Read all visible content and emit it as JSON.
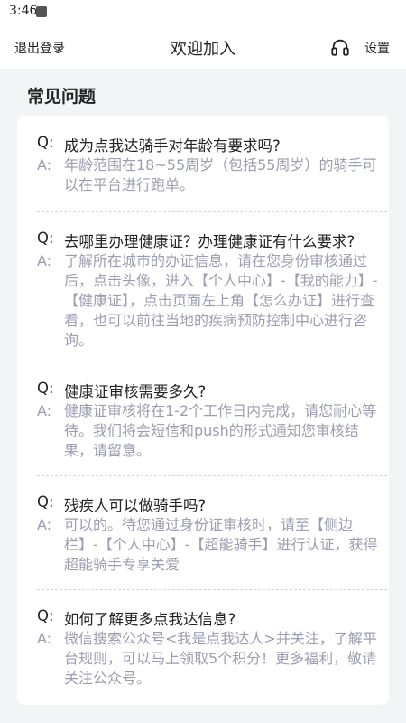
{
  "status_bar": {
    "time": "3:46"
  },
  "nav": {
    "logout": "退出登录",
    "title": "欢迎加入",
    "settings": "设置"
  },
  "faq": {
    "title": "常见问题",
    "q_prefix": "Q:",
    "a_prefix": "A:",
    "items": [
      {
        "q": "成为点我达骑手对年龄有要求吗?",
        "a": "年龄范围在18~55周岁（包括55周岁）的骑手可以在平台进行跑单。"
      },
      {
        "q": "去哪里办理健康证？办理健康证有什么要求?",
        "a": "了解所在城市的办证信息，请在您身份审核通过后，点击头像，进入【个人中心】-【我的能力】-【健康证】，点击页面左上角【怎么办证】进行查看，也可以前往当地的疾病预防控制中心进行咨询。"
      },
      {
        "q": "健康证审核需要多久?",
        "a": "健康证审核将在1-2个工作日内完成，请您耐心等待。我们将会短信和push的形式通知您审核结果，请留意。"
      },
      {
        "q": "残疾人可以做骑手吗?",
        "a": "可以的。待您通过身份证审核时，请至【侧边栏】-【个人中心】-【超能骑手】进行认证，获得超能骑手专享关爱"
      },
      {
        "q": "如何了解更多点我达信息?",
        "a": "微信搜索公众号<我是点我达人>并关注，了解平台规则，可以马上领取5个积分！更多福利，敬请关注公众号。"
      }
    ]
  }
}
